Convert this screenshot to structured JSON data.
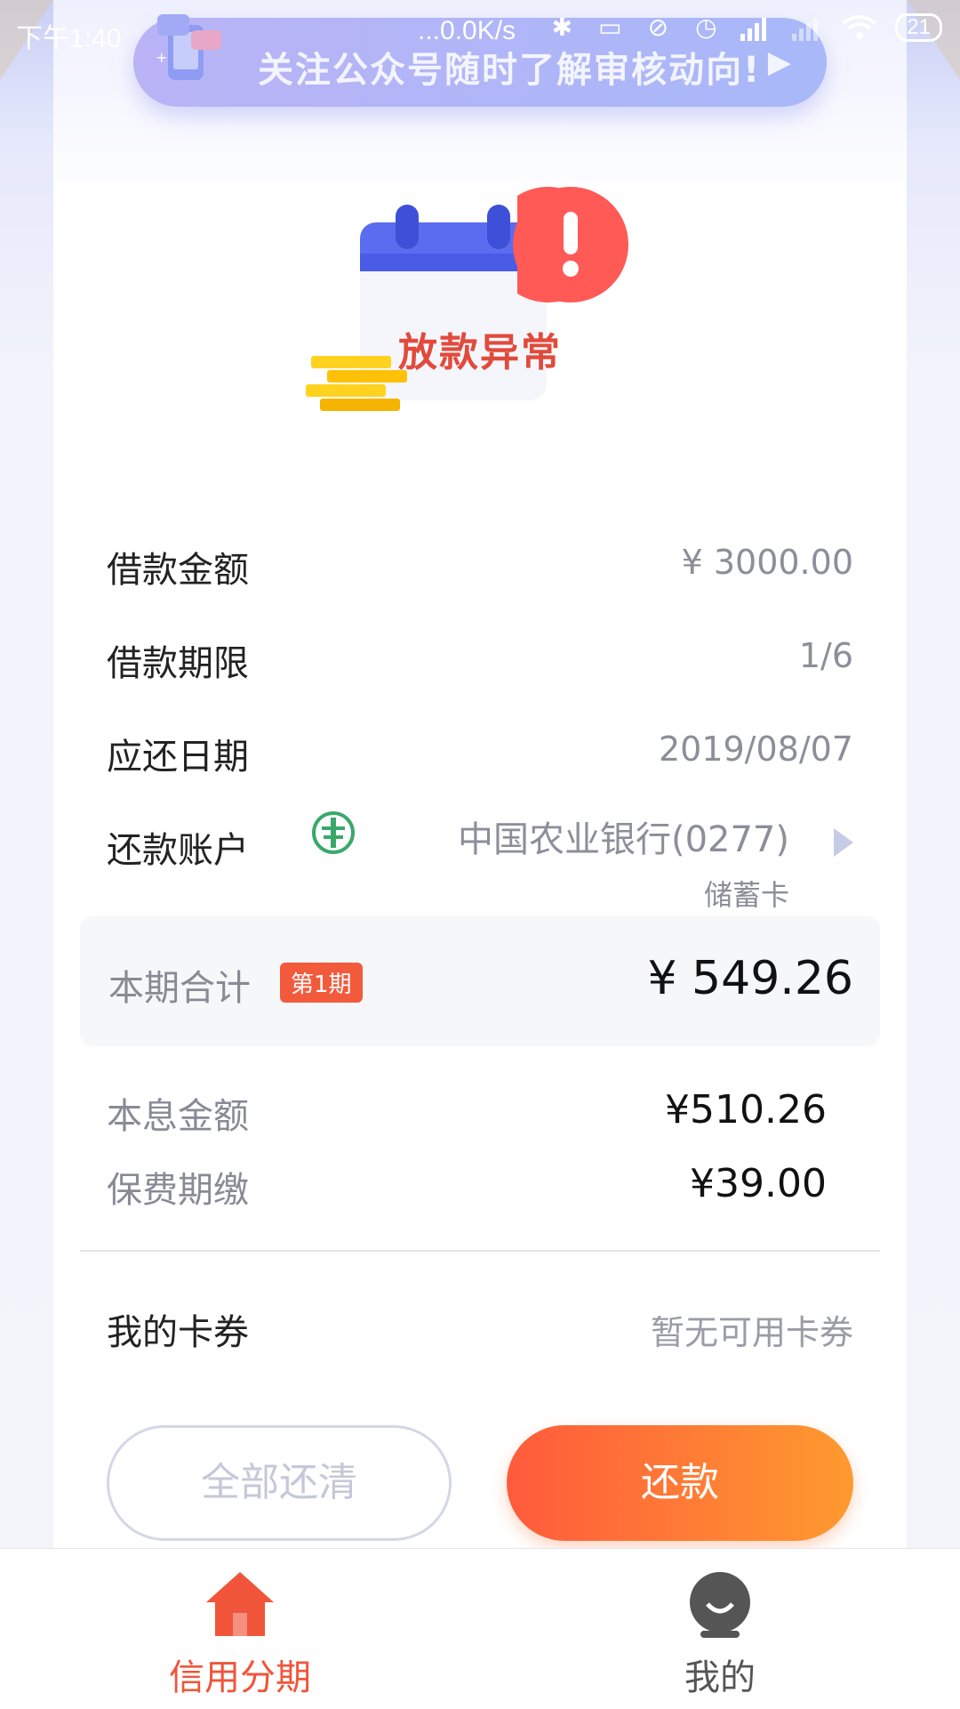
{
  "status_bar": {
    "time": "下午1:40",
    "net_speed": "...0.0K/s",
    "battery": "21",
    "icons": [
      "bluetooth-icon",
      "vibrate-icon",
      "dnd-icon",
      "alarm-icon",
      "signal-icon",
      "signal2-icon",
      "wifi-icon"
    ]
  },
  "banner": {
    "text": "关注公众号随时了解审核动向!",
    "arrow": "▶"
  },
  "illustration": {
    "label": "放款异常"
  },
  "loan": {
    "amount_label": "借款金额",
    "amount_value": "¥ 3000.00",
    "term_label": "借款期限",
    "term_value": "1/6",
    "due_label": "应还日期",
    "due_value": "2019/08/07",
    "account_label": "还款账户",
    "account_bank": "中国农业银行(0277)",
    "account_type": "储蓄卡"
  },
  "total": {
    "label": "本期合计",
    "badge": "第1期",
    "amount": "¥ 549.26"
  },
  "breakdown": {
    "principal_label": "本息金额",
    "principal_value": "¥510.26",
    "fee_label": "保费期缴",
    "fee_value": "¥39.00"
  },
  "coupon": {
    "label": "我的卡券",
    "value": "暂无可用卡券"
  },
  "buttons": {
    "clear_all": "全部还清",
    "repay": "还款"
  },
  "tabs": {
    "home": "信用分期",
    "me": "我的"
  },
  "colors": {
    "accent": "#f0553a",
    "pay_gradient_start": "#ff5a3c",
    "pay_gradient_end": "#ff9a2f",
    "warning_red": "#e24a3b",
    "banner": "#b9b3f6"
  }
}
